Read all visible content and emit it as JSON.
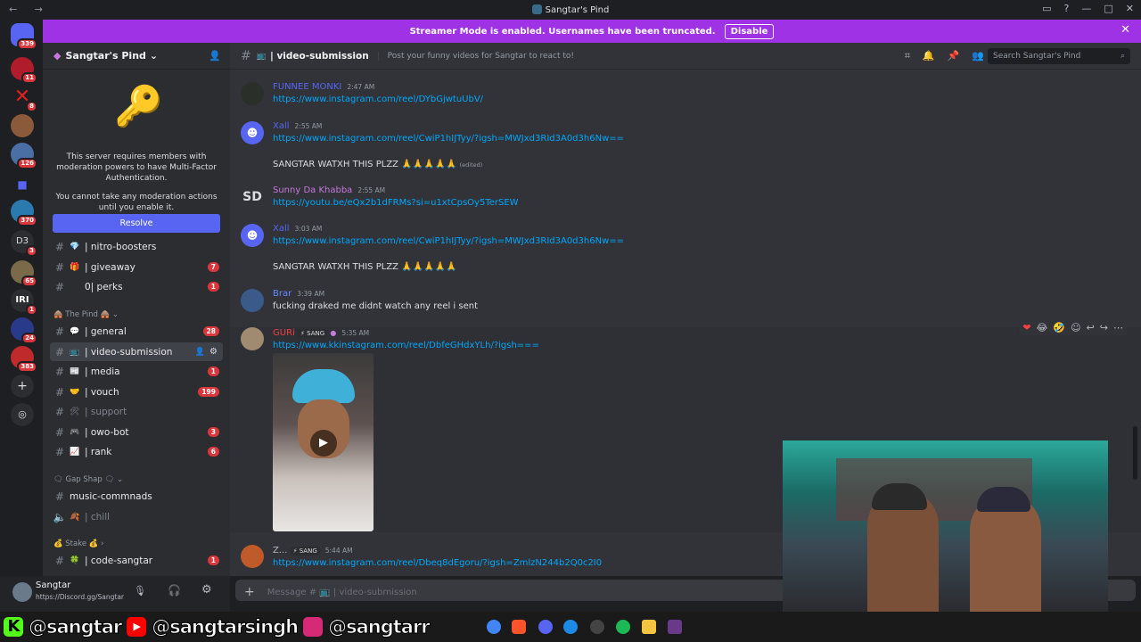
{
  "window": {
    "title": "Sangtar's Pind",
    "nav": "← →"
  },
  "streamer": {
    "text": "Streamer Mode is enabled. Usernames have been truncated.",
    "disable": "Disable"
  },
  "guilds": [
    {
      "badge": "339"
    },
    {
      "badge": "11"
    },
    {
      "badge": "8"
    },
    {
      "badge": ""
    },
    {
      "badge": "126"
    },
    {
      "badge": ""
    },
    {
      "badge": "370"
    },
    {
      "label": "D3",
      "badge": "3"
    },
    {
      "badge": "65"
    },
    {
      "label": "IRI",
      "badge": "1"
    },
    {
      "badge": "24"
    },
    {
      "badge": "383"
    }
  ],
  "sidebar": {
    "server_name": "Sangtar's Pind",
    "mfa_text": "This server requires members with moderation powers to have Multi-Factor Authentication.",
    "mfa_sub": "You cannot take any moderation actions until you enable it.",
    "resolve": "Resolve",
    "channels": [
      {
        "emoji": "💎",
        "name": "| nitro-boosters",
        "badge": ""
      },
      {
        "emoji": "🎁",
        "name": "| giveaway",
        "badge": "7"
      },
      {
        "emoji": "",
        "name": "0| perks",
        "badge": "1"
      },
      {
        "emoji": "💬",
        "name": "| general",
        "badge": "28"
      },
      {
        "emoji": "📺",
        "name": "| video-submission",
        "badge": ""
      },
      {
        "emoji": "📰",
        "name": "| media",
        "badge": "1"
      },
      {
        "emoji": "🤝",
        "name": "| vouch",
        "badge": "199"
      },
      {
        "emoji": "🛠",
        "name": "| support",
        "badge": ""
      },
      {
        "emoji": "🎮",
        "name": "| owo-bot",
        "badge": "3"
      },
      {
        "emoji": "📈",
        "name": "| rank",
        "badge": "6"
      },
      {
        "emoji": "",
        "name": "music-commnads",
        "badge": ""
      },
      {
        "emoji": "🍂",
        "name": "| chill",
        "badge": ""
      },
      {
        "emoji": "🍀",
        "name": "| code-sangtar",
        "badge": "1"
      }
    ],
    "categories": [
      "🛖 The Pind 🛖",
      "🗨 Gap Shap 🗨",
      "💰 Stake 💰"
    ]
  },
  "user": {
    "name": "Sangtar",
    "status": "https://Discord.gg/Sangtar"
  },
  "chat": {
    "channel": "| video-submission",
    "topic": "Post your funny videos for Sangtar to react to!",
    "search_placeholder": "Search Sangtar's Pind",
    "input_placeholder": "Message # 📺 | video-submission",
    "messages": [
      {
        "user": "FUNNEE MONKI",
        "time": "2:47 AM",
        "color": "#5865f2",
        "link": "https://www.instagram.com/reel/DYbGjwtuUbV/"
      },
      {
        "user": "Xall",
        "time": "2:55 AM",
        "color": "#5865f2",
        "link": "https://www.instagram.com/reel/CwiP1hIJTyy/?igsh=MWJxd3RId3A0d3h6Nw==",
        "text": "SANGTAR WATXH THIS PLZZ 🙏🙏🙏🙏🙏",
        "edited": "(edited)"
      },
      {
        "user": "Sunny Da Khabba",
        "time": "2:55 AM",
        "color": "#c678dd",
        "avatar": "SD",
        "link": "https://youtu.be/eQx2b1dFRMs?si=u1xtCpsOy5TerSEW"
      },
      {
        "user": "Xall",
        "time": "3:03 AM",
        "color": "#5865f2",
        "link": "https://www.instagram.com/reel/CwiP1hIJTyy/?igsh=MWJxd3RId3A0d3h6Nw==",
        "text": "SANGTAR WATXH THIS PLZZ 🙏🙏🙏🙏🙏"
      },
      {
        "user": "Brar",
        "time": "3:39 AM",
        "color": "#6b8afd",
        "text": "fucking draked me didnt watch any reel i sent"
      },
      {
        "user": "GURi",
        "tag": "⚡ SANG",
        "time": "5:35 AM",
        "color": "#f23f43",
        "link": "https://www.kkinstagram.com/reel/DbfeGHdxYLh/?igsh==="
      },
      {
        "user": "Z...",
        "tag": "⚡ SANG",
        "time": "5:44 AM",
        "color": "#b5bac1",
        "link": "https://www.instagram.com/reel/Dbeq8dEgoru/?igsh=ZmlzN244b2Q0c2I0"
      }
    ]
  },
  "social": {
    "kick": "@sangtar",
    "youtube": "@sangtarsingh",
    "instagram": "@sangtarr"
  },
  "colors": {
    "accent": "#5865f2",
    "streamer": "#a032e6",
    "link": "#00a8fc",
    "badge": "#da373c"
  }
}
